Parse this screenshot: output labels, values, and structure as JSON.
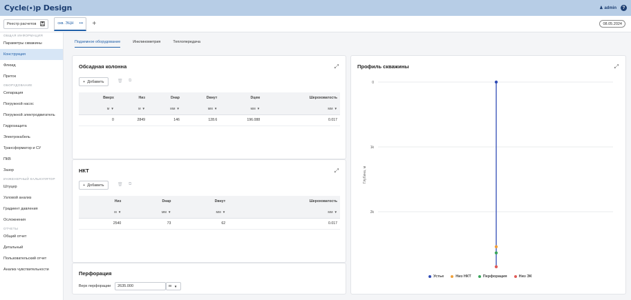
{
  "app": {
    "logo": "Cycle",
    "logo_mid": "(•)",
    "logo_tail": "p",
    "logo_suffix": "Design",
    "user": "admin",
    "help_icon": "?"
  },
  "tabs": {
    "registry_label": "Реестр расчетов",
    "doc_tab": "скв. ЭЦН",
    "doc_menu": "•••",
    "add": "+",
    "date": "08.05.2024"
  },
  "sidebar": {
    "sections": [
      {
        "title": "ОБЩАЯ ИНФОРМАЦИЯ",
        "items": [
          "Параметры скважины",
          "Конструкция",
          "Флюид",
          "Приток"
        ]
      },
      {
        "title": "ОБОРУДОВАНИЕ",
        "items": [
          "Сепарация",
          "Погружной насос",
          "Погружной электродвигатель",
          "Гидрозащита",
          "Электрокабель",
          "Трансформатор и СУ",
          "ПКВ",
          "Зазор"
        ]
      },
      {
        "title": "ИНЖЕНЕРНЫЙ КАЛЬКУЛЯТОР",
        "items": [
          "Штуцер",
          "Узловой анализ",
          "Градиент давления",
          "Осложнения"
        ]
      },
      {
        "title": "ОТЧЕТЫ",
        "items": [
          "Общий отчет",
          "Детальный",
          "Пользовательский отчет",
          "Анализ чувствительности"
        ]
      }
    ],
    "active_item": "Конструкция"
  },
  "subtabs": [
    "Подземное оборудование",
    "Инклинометрия",
    "Теплопередача"
  ],
  "casing": {
    "title": "Обсадная колонна",
    "add_label": "Добавить",
    "headers": [
      "Вверх",
      "Низ",
      "Dнар",
      "Dвнут",
      "Dцем",
      "Шероховатость"
    ],
    "units": [
      "м",
      "м",
      "мм",
      "мм",
      "мм",
      "мм"
    ],
    "rows": [
      [
        "0",
        "2849",
        "146",
        "128.6",
        "196.088",
        "0.017"
      ]
    ]
  },
  "tubing": {
    "title": "НКТ",
    "add_label": "Добавить",
    "headers": [
      "Низ",
      "Dнар",
      "Dвнут",
      "Шероховатость"
    ],
    "units": [
      "м",
      "мм",
      "мм",
      "мм"
    ],
    "rows": [
      [
        "2540",
        "73",
        "62",
        "0.017"
      ]
    ]
  },
  "perforation": {
    "title": "Перфорация",
    "label": "Верх перфорации",
    "value": "2635.000",
    "unit": "м"
  },
  "profile": {
    "title": "Профиль скважины",
    "y_axis_label": "Глубина, м",
    "legend": [
      {
        "label": "Устье",
        "color": "#2f4bb5"
      },
      {
        "label": "Низ НКТ",
        "color": "#f0a13a"
      },
      {
        "label": "Перфорация",
        "color": "#3aa55c"
      },
      {
        "label": "Низ ЭК",
        "color": "#e05b57"
      }
    ]
  },
  "chart_data": {
    "type": "line",
    "title": "Профиль скважины",
    "ylabel": "Глубина, м",
    "y_ticks": [
      "0",
      "1k",
      "2k"
    ],
    "ylim": [
      2849,
      0
    ],
    "series": [
      {
        "name": "Устье",
        "depth": 0,
        "color": "#2f4bb5"
      },
      {
        "name": "Низ НКТ",
        "depth": 2540,
        "color": "#f0a13a"
      },
      {
        "name": "Перфорация",
        "depth": 2635,
        "color": "#3aa55c"
      },
      {
        "name": "Низ ЭК",
        "depth": 2849,
        "color": "#e05b57"
      }
    ],
    "grid": true,
    "legend_position": "bottom"
  }
}
